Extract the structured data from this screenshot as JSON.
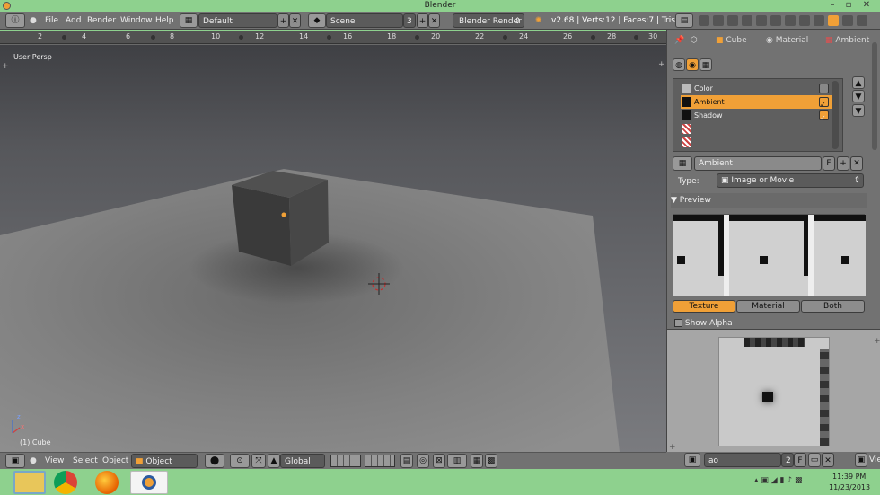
{
  "window": {
    "title": "Blender",
    "minimize": "–",
    "maximize": "▫",
    "close": "✕"
  },
  "topbar": {
    "menus": [
      "File",
      "Add",
      "Render",
      "Window",
      "Help"
    ],
    "screen_layout": "Default",
    "scene": "Scene",
    "scene_users": "3",
    "render_engine": "Blender Render",
    "stats": "v2.68 | Verts:12 | Faces:7 | Tris:14"
  },
  "ruler": {
    "labels": [
      "2",
      "4",
      "6",
      "8",
      "10",
      "12",
      "14",
      "16",
      "18",
      "20",
      "22",
      "24",
      "26",
      "28",
      "30"
    ]
  },
  "viewport": {
    "view_name": "User Persp",
    "object_label": "(1) Cube",
    "axis_x": "x",
    "axis_z": "z"
  },
  "viewport_header": {
    "menus": [
      "View",
      "Select",
      "Object"
    ],
    "mode": "Object Mode",
    "orientation": "Global"
  },
  "properties": {
    "context": {
      "object": "Cube",
      "material": "Material",
      "texture": "Ambient"
    },
    "texture_slots": [
      {
        "label": "Color",
        "selected": false,
        "checked": false
      },
      {
        "label": "Ambient",
        "selected": true,
        "checked": true
      },
      {
        "label": "Shadow",
        "selected": false,
        "checked": true
      },
      {
        "label": "",
        "selected": false,
        "checked": false
      },
      {
        "label": "",
        "selected": false,
        "checked": false
      }
    ],
    "texture_name": "Ambient",
    "fake_user": "F",
    "type_label": "Type:",
    "type_value": "Image or Movie",
    "preview_label": "Preview",
    "preview_tabs": [
      "Texture",
      "Material",
      "Both"
    ],
    "active_preview_tab": "Texture",
    "show_alpha": "Show Alpha"
  },
  "image_editor": {
    "view_menu": "View",
    "image_name": "ao",
    "image_users": "2",
    "fake_user": "F"
  },
  "taskbar": {
    "time": "11:39 PM",
    "date": "11/23/2013"
  },
  "colors": {
    "accent": "#f0a037",
    "window_green": "#8ed18e",
    "panel": "#727272"
  }
}
